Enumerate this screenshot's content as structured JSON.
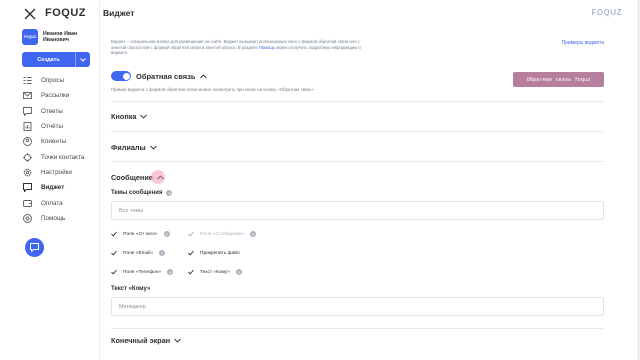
{
  "sidebar": {
    "logo": "FOQUZ",
    "user": {
      "avatar_text": "FOQUZ",
      "name": "Иванов Иван Иванович"
    },
    "create_label": "Создать",
    "items": [
      {
        "label": "Опросы",
        "icon": "list-icon"
      },
      {
        "label": "Рассылки",
        "icon": "mail-icon"
      },
      {
        "label": "Ответы",
        "icon": "chat-icon"
      },
      {
        "label": "Отчёты",
        "icon": "report-icon"
      },
      {
        "label": "Клиенты",
        "icon": "users-icon"
      },
      {
        "label": "Точки контакта",
        "icon": "target-icon"
      },
      {
        "label": "Настройки",
        "icon": "gear-icon"
      },
      {
        "label": "Виджет",
        "icon": "widget-icon",
        "active": true
      },
      {
        "label": "Оплата",
        "icon": "wallet-icon"
      },
      {
        "label": "Помощь",
        "icon": "help-icon"
      }
    ]
  },
  "header": {
    "title": "Виджет",
    "brand": "FOQUZ"
  },
  "intro": {
    "text": "Виджет – специальная кнопка для размещения на сайте. Виджет вызывает всплывающее окно с формой обратной связи или с анкетой опроса или с формой обратной связи и анкетой опроса. В разделе",
    "link": "Помощь",
    "text_after": "можно получить подробную информацию о виджете.",
    "examples_link": "Примеры виджета"
  },
  "feedback": {
    "toggle_label": "Обратная связь",
    "preview_button": "Обратная связь foquz",
    "hint": "Пример виджета с формой обратной связи можно посмотреть при клике на кнопку «Обратная связь»"
  },
  "sections": {
    "button": "Кнопка",
    "branches": "Филиалы",
    "message": "Сообщение",
    "end_screen": "Конечный экран"
  },
  "message": {
    "topics_label": "Темы сообщения",
    "topics_placeholder": "Все темы",
    "checkboxes": [
      {
        "label": "Поле «От кого»",
        "checked": true,
        "disabled": false,
        "info": true
      },
      {
        "label": "Поле «Сообщение»",
        "checked": true,
        "disabled": true,
        "info": true
      },
      {
        "label": "Поле «Email»",
        "checked": true,
        "disabled": false,
        "info": true
      },
      {
        "label": "Прикрепить файл",
        "checked": true,
        "disabled": false,
        "info": false
      },
      {
        "label": "Поле «Телефон»",
        "checked": true,
        "disabled": false,
        "info": true
      },
      {
        "label": "Текст «Кому»",
        "checked": true,
        "disabled": false,
        "info": true
      }
    ],
    "to_label": "Текст «Кому»",
    "to_placeholder": "Менеджер"
  },
  "colors": {
    "accent": "#3f65f1",
    "preview_button": "#b87ea0",
    "muted": "#73808d"
  }
}
